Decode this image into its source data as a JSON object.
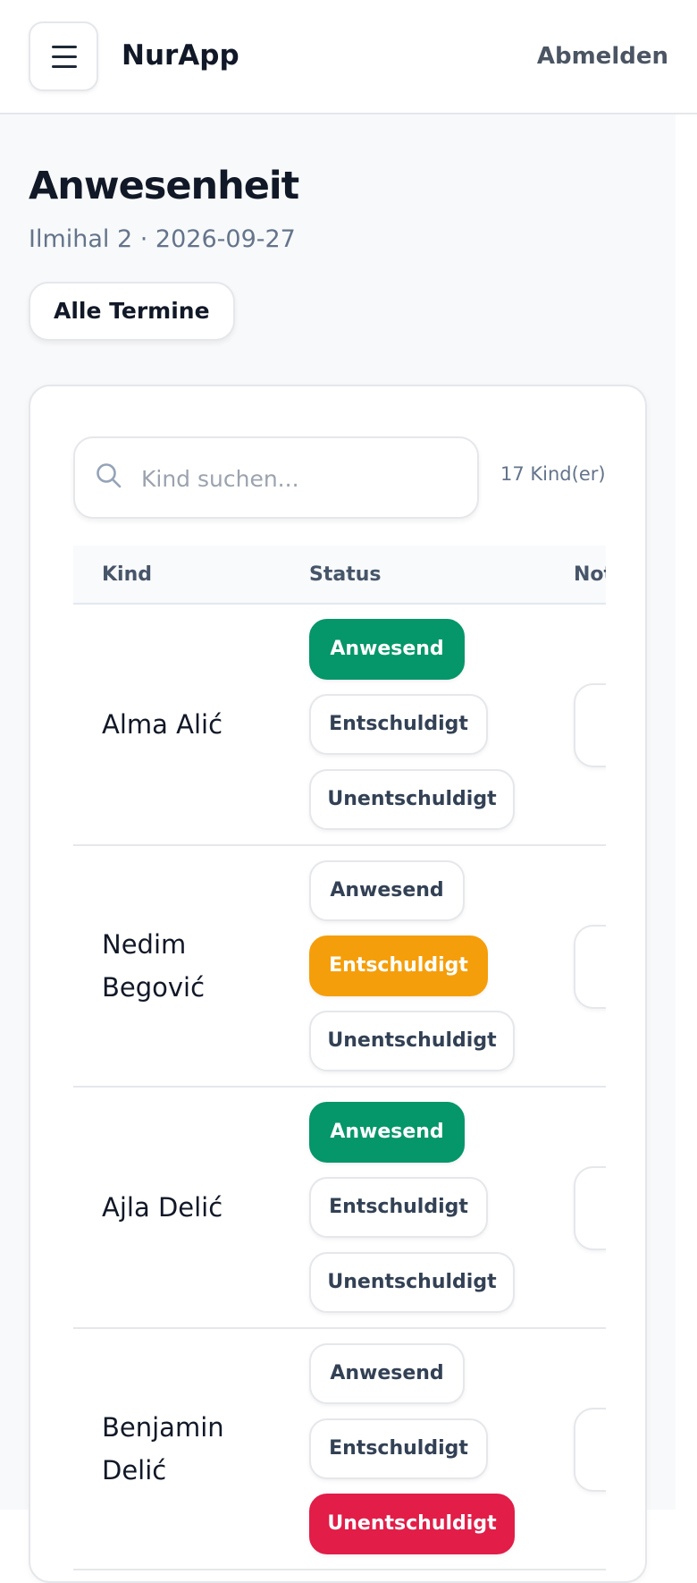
{
  "header": {
    "app_title": "NurApp",
    "logout_label": "Abmelden"
  },
  "page": {
    "title": "Anwesenheit",
    "subtitle": "Ilmihal 2 · 2026-09-27",
    "all_dates_label": "Alle Termine"
  },
  "search": {
    "placeholder": "Kind suchen...",
    "value": "",
    "count_text": "17 Kind(er)"
  },
  "table": {
    "columns": [
      "Kind",
      "Status",
      "Notiz"
    ],
    "status_labels": [
      "Anwesend",
      "Entschuldigt",
      "Unentschuldigt"
    ],
    "rows": [
      {
        "name": "Alma Alić",
        "status": "Anwesend"
      },
      {
        "name": "Nedim Begović",
        "status": "Entschuldigt"
      },
      {
        "name": "Ajla Delić",
        "status": "Anwesend"
      },
      {
        "name": "Benjamin Delić",
        "status": "Unentschuldigt"
      }
    ]
  },
  "colors": {
    "present": "#059669",
    "excused": "#f59e0b",
    "unexcused": "#e11d48"
  }
}
